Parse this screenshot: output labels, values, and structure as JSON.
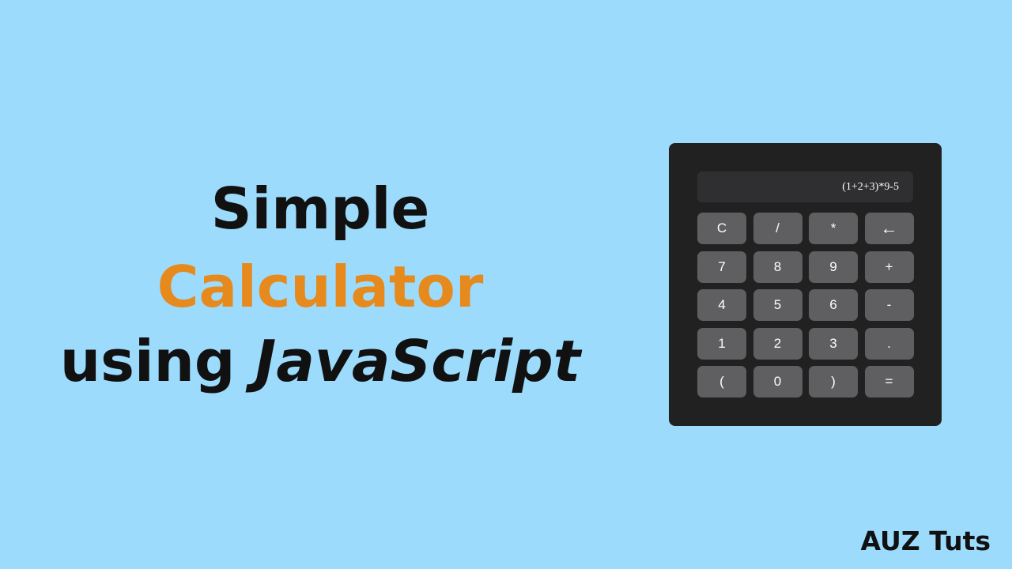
{
  "headline": {
    "line1": "Simple",
    "line2": "Calculator",
    "line3_part1": "using ",
    "line3_part2": "JavaScript",
    "colors": {
      "primary": "#111111",
      "accent": "#e68a1e"
    }
  },
  "calculator": {
    "display": "(1+2+3)*9-5",
    "keys": [
      [
        "C",
        "/",
        "*",
        "←"
      ],
      [
        "7",
        "8",
        "9",
        "+"
      ],
      [
        "4",
        "5",
        "6",
        "-"
      ],
      [
        "1",
        "2",
        "3",
        "."
      ],
      [
        "(",
        "0",
        ")",
        "="
      ]
    ]
  },
  "brand": "AUZ Tuts",
  "colors": {
    "background": "#9cdbfc",
    "calculator_body": "#212121",
    "display_bg": "#2f2f32",
    "key_bg": "#5f5f61",
    "key_text": "#ffffff"
  }
}
